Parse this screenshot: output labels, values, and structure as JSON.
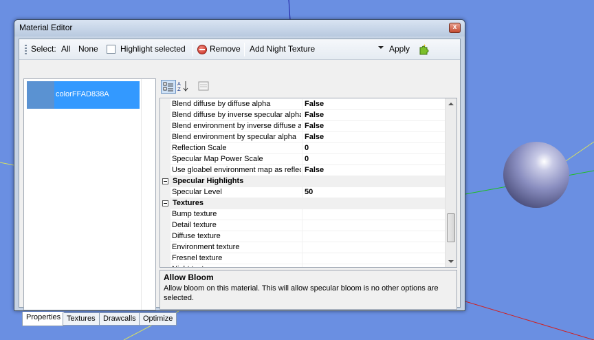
{
  "window": {
    "title": "Material Editor",
    "close_glyph": "x"
  },
  "toolbar": {
    "select_label": "Select:",
    "all_label": "All",
    "none_label": "None",
    "highlight_label": "Highlight selected",
    "remove_label": "Remove",
    "add_texture_label": "Add Night Texture",
    "apply_label": "Apply"
  },
  "materials": [
    {
      "label": "colorFFAD838A",
      "swatch": "#5a92d2"
    }
  ],
  "properties": [
    {
      "kind": "prop",
      "name": "Blend diffuse by diffuse alpha",
      "value": "False"
    },
    {
      "kind": "prop",
      "name": "Blend diffuse by inverse specular alpha",
      "value": "False"
    },
    {
      "kind": "prop",
      "name": "Blend environment by inverse diffuse alpha",
      "value": "False"
    },
    {
      "kind": "prop",
      "name": "Blend environment by specular alpha",
      "value": "False"
    },
    {
      "kind": "prop",
      "name": "Reflection Scale",
      "value": "0"
    },
    {
      "kind": "prop",
      "name": "Specular Map Power Scale",
      "value": "0"
    },
    {
      "kind": "prop",
      "name": "Use gloabel environment map as reflection",
      "value": "False"
    },
    {
      "kind": "cat",
      "name": "Specular Highlights"
    },
    {
      "kind": "prop",
      "name": "Specular Level",
      "value": "50"
    },
    {
      "kind": "cat",
      "name": "Textures"
    },
    {
      "kind": "prop",
      "name": "Bump texture",
      "value": ""
    },
    {
      "kind": "prop",
      "name": "Detail texture",
      "value": ""
    },
    {
      "kind": "prop",
      "name": "Diffuse texture",
      "value": ""
    },
    {
      "kind": "prop",
      "name": "Environment texture",
      "value": ""
    },
    {
      "kind": "prop",
      "name": "Fresnel texture",
      "value": ""
    },
    {
      "kind": "prop",
      "name": "Night texture",
      "value": ""
    }
  ],
  "help": {
    "title": "Allow Bloom",
    "description": "Allow bloom on this material. This will allow specular bloom is no other options are selected."
  },
  "tabs": [
    {
      "label": "Properties",
      "active": true
    },
    {
      "label": "Textures",
      "active": false
    },
    {
      "label": "Drawcalls",
      "active": false
    },
    {
      "label": "Optimize",
      "active": false
    }
  ],
  "colors": {
    "viewport_bg": "#6a8fe2",
    "selection": "#3399ff",
    "sphere": "#8a8fc0"
  }
}
